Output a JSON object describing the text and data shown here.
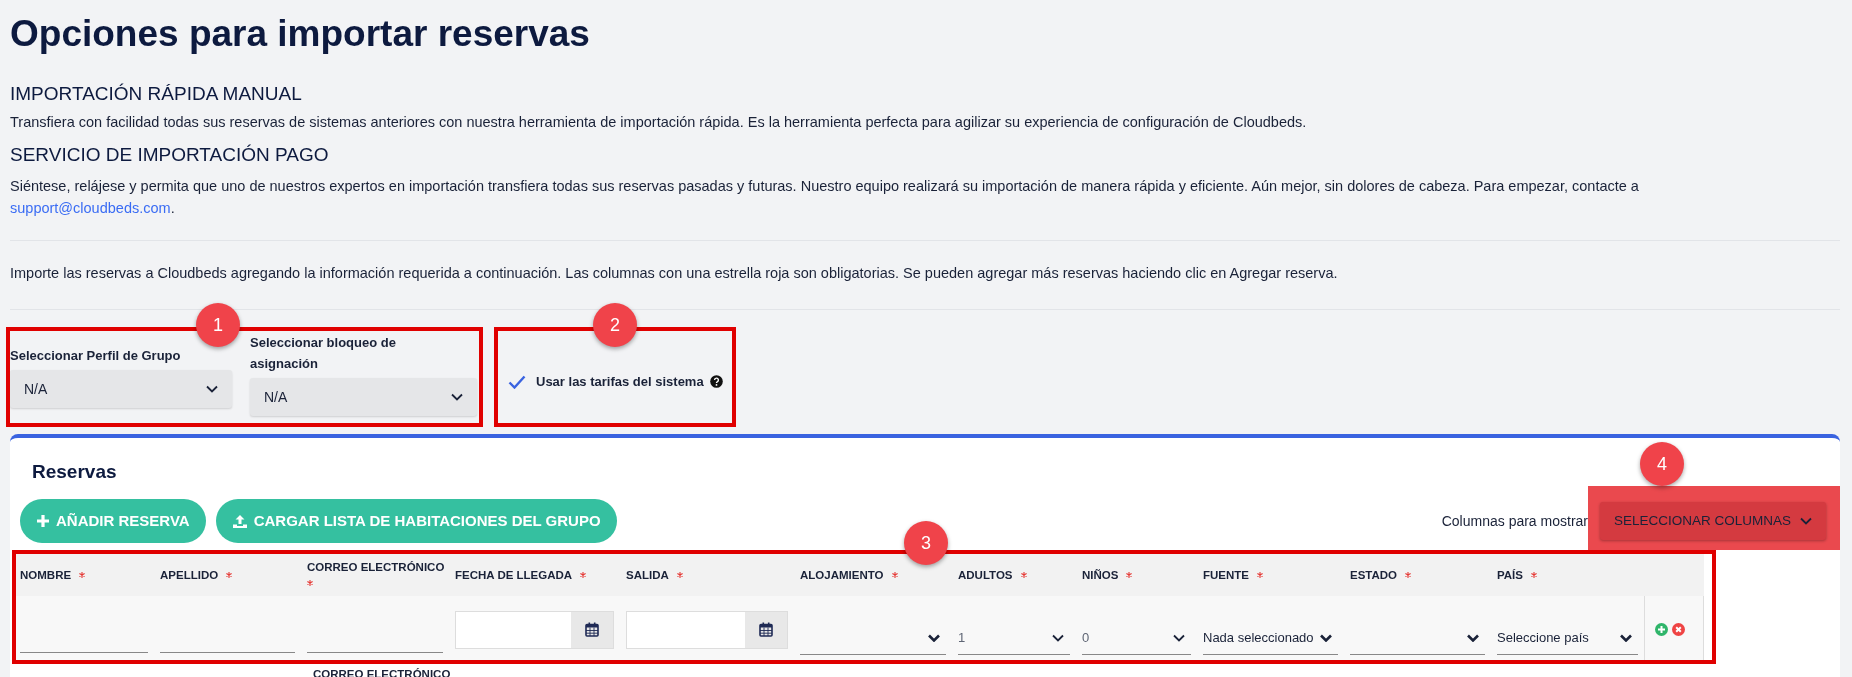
{
  "title": "Opciones para importar reservas",
  "sections": [
    {
      "heading": "IMPORTACIÓN RÁPIDA MANUAL",
      "text": "Transfiera con facilidad todas sus reservas de sistemas anteriores con nuestra herramienta de importación rápida. Es la herramienta perfecta para agilizar su experiencia de configuración de Cloudbeds."
    },
    {
      "heading": "SERVICIO DE IMPORTACIÓN PAGO",
      "text": "Siéntese, relájese y permita que uno de nuestros expertos en importación transfiera todas sus reservas pasadas y futuras. Nuestro equipo realizará su importación de manera rápida y eficiente. Aún mejor, sin dolores de cabeza. Para empezar, contacte a",
      "link": "support@cloudbeds.com",
      "text_after": "."
    }
  ],
  "instructions": "Importe las reservas a Cloudbeds agregando la información requerida a continuación. Las columnas con una estrella roja son obligatorias. Se pueden agregar más reservas haciendo clic en Agregar reserva.",
  "group_profile": {
    "label": "Seleccionar Perfil de Grupo",
    "value": "N/A"
  },
  "allocation_block": {
    "label": "Seleccionar bloqueo de asignación",
    "value": "N/A"
  },
  "system_rates": {
    "label": "Usar las tarifas del sistema",
    "checked": true
  },
  "reservations": {
    "title": "Reservas",
    "buttons": [
      {
        "label": "AÑADIR RESERVA"
      },
      {
        "label": "CARGAR LISTA DE HABITACIONES DEL GRUPO"
      }
    ],
    "columns_label": "Columnas para mostrar",
    "columns_button": "SELECCIONAR COLUMNAS",
    "columns": [
      {
        "label": "NOMBRE",
        "required": true
      },
      {
        "label": "APELLIDO",
        "required": true
      },
      {
        "label": "CORREO ELECTRÓNICO",
        "required": true
      },
      {
        "label": "FECHA DE LLEGADA",
        "required": true
      },
      {
        "label": "SALIDA",
        "required": true
      },
      {
        "label": "ALOJAMIENTO",
        "required": true
      },
      {
        "label": "ADULTOS",
        "required": true
      },
      {
        "label": "NIÑOS",
        "required": true
      },
      {
        "label": "FUENTE",
        "required": true
      },
      {
        "label": "ESTADO",
        "required": true
      },
      {
        "label": "PAÍS",
        "required": true
      }
    ],
    "rows": [
      {
        "cells": [
          {
            "kind": "input"
          },
          {
            "kind": "input"
          },
          {
            "kind": "input"
          },
          {
            "kind": "date"
          },
          {
            "kind": "date"
          },
          {
            "kind": "select"
          },
          {
            "kind": "select",
            "value": "1",
            "muted": true
          },
          {
            "kind": "select",
            "value": "0",
            "muted": true
          },
          {
            "kind": "select",
            "value": "Nada seleccionado",
            "muted": false
          },
          {
            "kind": "select"
          },
          {
            "kind": "select",
            "value": "Seleccione país",
            "muted": false
          }
        ]
      }
    ],
    "repeated_header": "CORREO ELECTRÓNICO"
  },
  "annotations": [
    {
      "number": "1",
      "kind": "outline"
    },
    {
      "number": "2",
      "kind": "outline"
    },
    {
      "number": "4",
      "kind": "filled"
    },
    {
      "number": "3",
      "kind": "outline"
    }
  ]
}
